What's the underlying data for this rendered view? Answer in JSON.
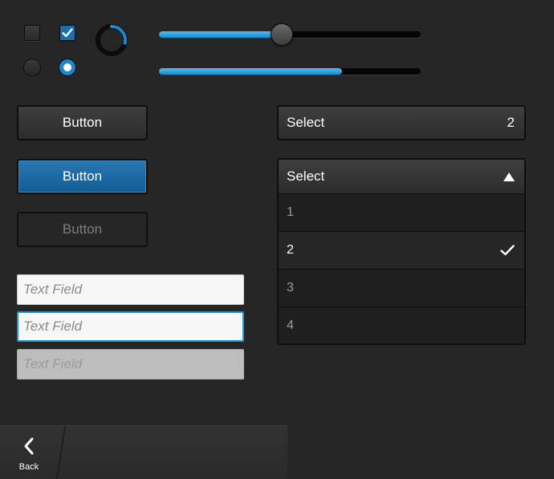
{
  "controls": {
    "checkbox_off": {
      "checked": false
    },
    "checkbox_on": {
      "checked": true
    },
    "radio_off": {
      "selected": false
    },
    "radio_on": {
      "selected": true
    },
    "slider": {
      "value_percent": 47
    },
    "progress": {
      "value_percent": 70
    }
  },
  "buttons": {
    "default_label": "Button",
    "primary_label": "Button",
    "disabled_label": "Button"
  },
  "text_fields": {
    "normal_placeholder": "Text Field",
    "focused_placeholder": "Text Field",
    "disabled_placeholder": "Text Field"
  },
  "select_closed": {
    "label": "Select",
    "value": "2"
  },
  "select_open": {
    "label": "Select",
    "options": [
      "1",
      "2",
      "3",
      "4"
    ],
    "selected": "2"
  },
  "action_bar": {
    "back_label": "Back",
    "back_icon": "chevron-left-icon"
  },
  "colors": {
    "background": "#262626",
    "accent": "#1e86cc",
    "primary_button": "#1d6aa6"
  }
}
